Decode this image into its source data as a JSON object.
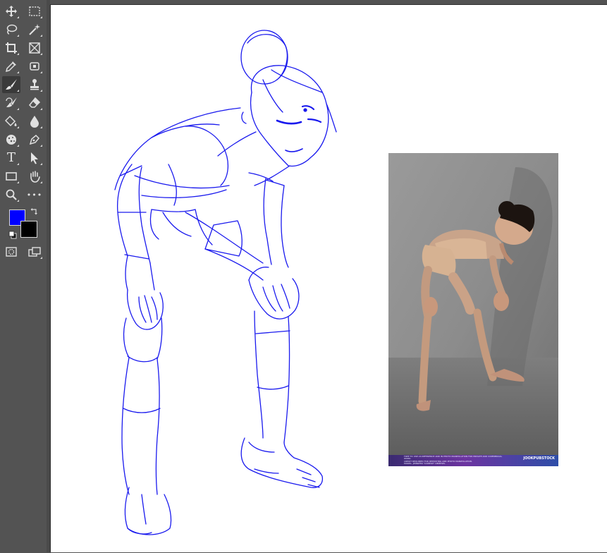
{
  "tools": [
    {
      "name": "move-tool",
      "icon": "move-icon"
    },
    {
      "name": "rectangular-marquee-tool",
      "icon": "marquee-icon"
    },
    {
      "name": "lasso-tool",
      "icon": "lasso-icon"
    },
    {
      "name": "magic-wand-tool",
      "icon": "magic-wand-icon"
    },
    {
      "name": "crop-tool",
      "icon": "crop-icon"
    },
    {
      "name": "frame-tool",
      "icon": "frame-icon"
    },
    {
      "name": "eyedropper-tool",
      "icon": "eyedropper-icon"
    },
    {
      "name": "spot-healing-tool",
      "icon": "bandage-icon"
    },
    {
      "name": "brush-tool",
      "icon": "brush-icon",
      "active": true
    },
    {
      "name": "clone-stamp-tool",
      "icon": "stamp-icon"
    },
    {
      "name": "history-brush-tool",
      "icon": "history-brush-icon"
    },
    {
      "name": "eraser-tool",
      "icon": "eraser-icon"
    },
    {
      "name": "paint-bucket-tool",
      "icon": "bucket-icon"
    },
    {
      "name": "blur-tool",
      "icon": "drop-icon"
    },
    {
      "name": "dodge-tool",
      "icon": "sponge-icon"
    },
    {
      "name": "pen-tool",
      "icon": "pen-icon"
    },
    {
      "name": "type-tool",
      "icon": "type-icon",
      "glyph": "T"
    },
    {
      "name": "path-selection-tool",
      "icon": "arrow-icon"
    },
    {
      "name": "rectangle-tool",
      "icon": "rectangle-icon"
    },
    {
      "name": "hand-tool",
      "icon": "hand-icon"
    },
    {
      "name": "zoom-tool",
      "icon": "magnifier-icon"
    },
    {
      "name": "edit-toolbar",
      "icon": "more-icon",
      "glyph": "•••"
    },
    {
      "name": "quick-mask-mode",
      "icon": "quick-mask-icon"
    },
    {
      "name": "screen-mode",
      "icon": "screen-mode-icon"
    }
  ],
  "colors": {
    "foreground": "#0000ff",
    "background": "#000000",
    "sketch_stroke": "#1a1aee",
    "canvas": "#ffffff"
  },
  "reference": {
    "caption": "FREE TO USE AS REFERENCE AND IN PHOTO MANIPULATION FOR PRIVATE AND COMMERCIAL WORK.\nCREDIT REQUIRED FOR REPOSTING AND PHOTO MANIPULATION.\nMODEL: JENNIFER \"COMPOP\" DEMPSEL",
    "brand": "JOOKPUBSTOCK"
  }
}
